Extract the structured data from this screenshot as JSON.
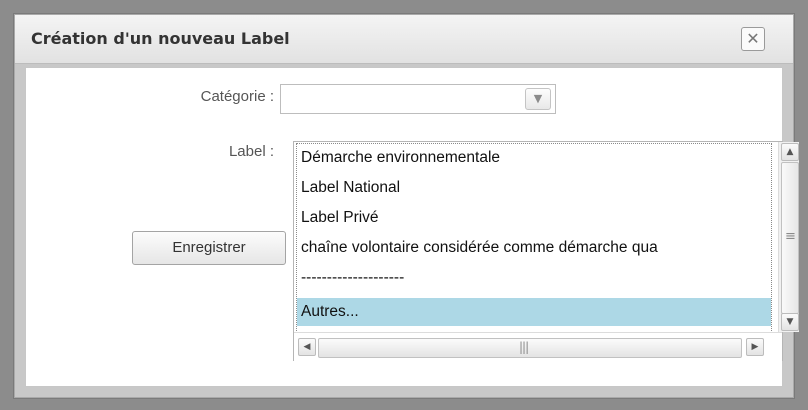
{
  "dialog": {
    "title": "Création d'un nouveau Label",
    "close_icon": "close-icon"
  },
  "form": {
    "categorie_label": "Catégorie :",
    "label_label": "Label :",
    "categorie_value": "",
    "save_label": "Enregistrer"
  },
  "dropdown": {
    "options": [
      "Démarche environnementale",
      "Label National",
      "Label Privé",
      "chaîne volontaire considérée comme démarche qua",
      "--------------------",
      "Autres..."
    ],
    "selected_index": 5
  },
  "icons": {
    "select_arrow": "chevron-down-icon",
    "scroll_up": "arrow-up-icon",
    "scroll_down": "arrow-down-icon",
    "scroll_left": "arrow-left-icon",
    "scroll_right": "arrow-right-icon"
  },
  "colors": {
    "selected_option": "#add8e6"
  }
}
